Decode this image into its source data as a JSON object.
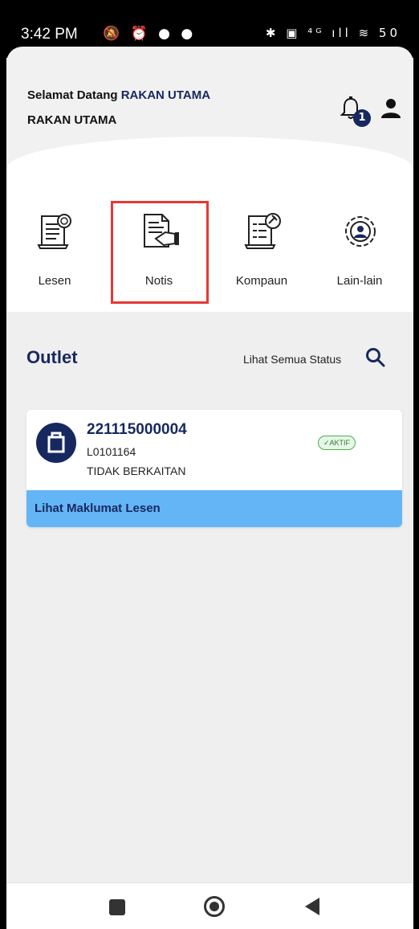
{
  "statusbar": {
    "time": "3:42 PM",
    "left_icons": "🔕 ⏰ ● ●",
    "right_icons": "✱ ▣ ⁴ᴳ ıll ≋ 50"
  },
  "header": {
    "welcome_prefix": "Selamat Datang",
    "welcome_name": "RAKAN UTAMA",
    "subname": "RAKAN UTAMA",
    "notification_count": "1"
  },
  "menu": {
    "items": [
      {
        "label": "Lesen",
        "icon": "license-document-icon"
      },
      {
        "label": "Notis",
        "icon": "notice-document-icon"
      },
      {
        "label": "Kompaun",
        "icon": "compound-document-icon"
      },
      {
        "label": "Lain-lain",
        "icon": "settings-gear-icon"
      }
    ]
  },
  "outlet": {
    "title": "Outlet",
    "view_all_status": "Lihat Semua Status",
    "card": {
      "number": "221115000004",
      "code": "L0101164",
      "description": "TIDAK BERKAITAN",
      "status": "✓AKTIF",
      "footer_label": "Lihat Maklumat Lesen"
    }
  },
  "colors": {
    "brand_navy": "#17285f",
    "footer_blue": "#64b5f6",
    "status_green": "#2e7d32",
    "highlight_red": "#e53935"
  }
}
